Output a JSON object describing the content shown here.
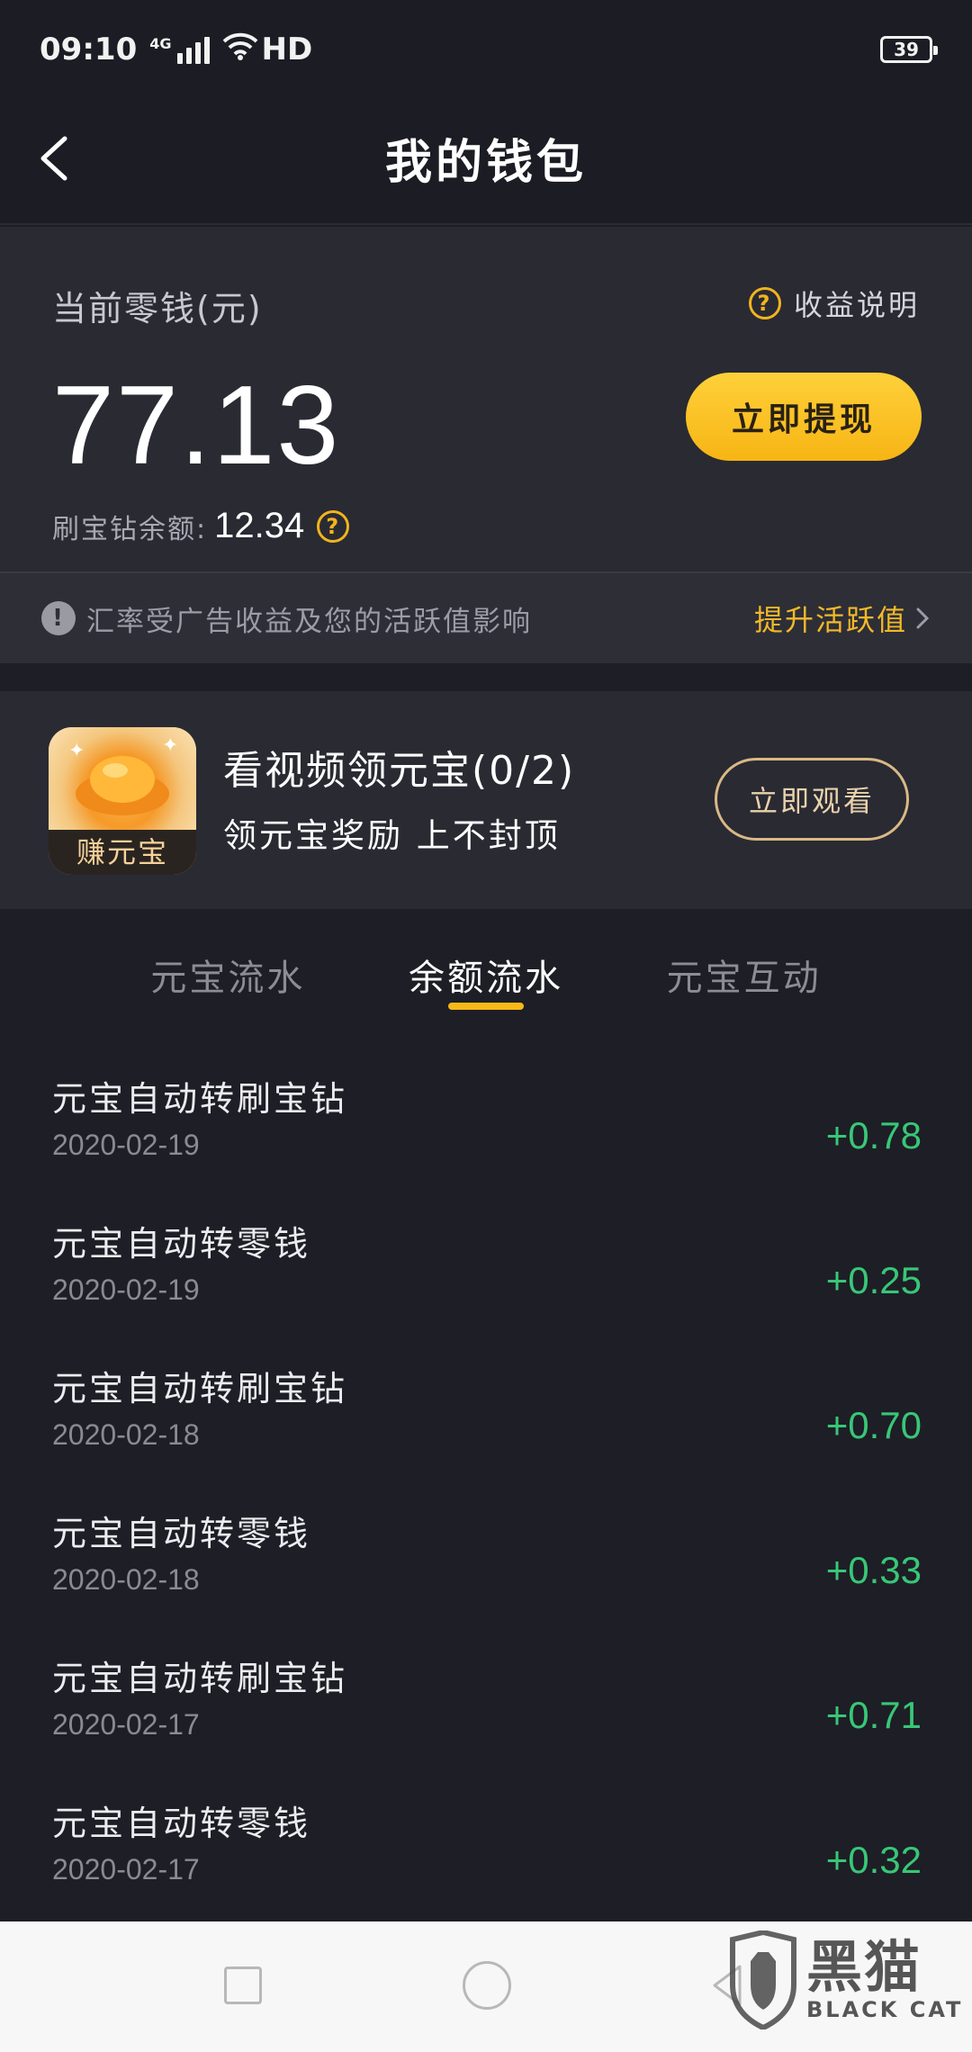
{
  "status_bar": {
    "time": "09:10",
    "network": "4G",
    "hd": "HD",
    "battery": "39"
  },
  "header": {
    "title": "我的钱包"
  },
  "wallet": {
    "balance_label": "当前零钱(元)",
    "help_label": "收益说明",
    "balance": "77.13",
    "withdraw_label": "立即提现",
    "diamond_label": "刷宝钻余额:",
    "diamond_balance": "12.34",
    "notice_text": "汇率受广告收益及您的活跃值影响",
    "boost_label": "提升活跃值"
  },
  "promo": {
    "icon_tag": "赚元宝",
    "title": "看视频领元宝(0/2)",
    "desc": "领元宝奖励 上不封顶",
    "watch_label": "立即观看"
  },
  "tabs": [
    {
      "label": "元宝流水",
      "active": false
    },
    {
      "label": "余额流水",
      "active": true
    },
    {
      "label": "元宝互动",
      "active": false
    }
  ],
  "transactions": [
    {
      "desc": "元宝自动转刷宝钻",
      "date": "2020-02-19",
      "amount": "+0.78"
    },
    {
      "desc": "元宝自动转零钱",
      "date": "2020-02-19",
      "amount": "+0.25"
    },
    {
      "desc": "元宝自动转刷宝钻",
      "date": "2020-02-18",
      "amount": "+0.70"
    },
    {
      "desc": "元宝自动转零钱",
      "date": "2020-02-18",
      "amount": "+0.33"
    },
    {
      "desc": "元宝自动转刷宝钻",
      "date": "2020-02-17",
      "amount": "+0.71"
    },
    {
      "desc": "元宝自动转零钱",
      "date": "2020-02-17",
      "amount": "+0.32"
    }
  ],
  "watermark": {
    "cn": "黑猫",
    "en": "BLACK CAT"
  },
  "colors": {
    "accent": "#f6b918",
    "positive": "#38c777",
    "background": "#1e1e26",
    "card": "#2a2a33"
  }
}
